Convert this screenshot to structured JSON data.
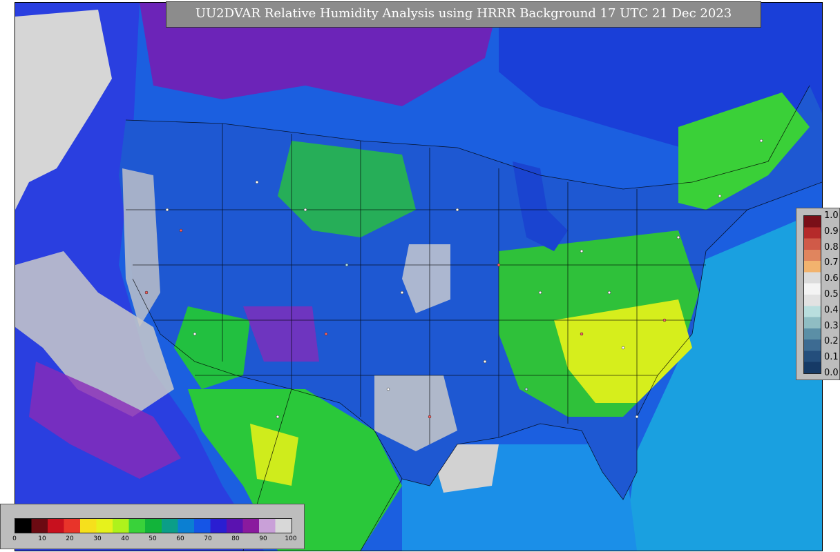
{
  "map": {
    "title": "UU2DVAR Relative Humidity Analysis using HRRR Background 17 UTC 21 Dec 2023",
    "region": "Continental United States",
    "variable": "Relative Humidity"
  },
  "legend_vertical": {
    "ticks": [
      "1.0",
      "0.9",
      "0.8",
      "0.7",
      "0.6",
      "0.5",
      "0.4",
      "0.3",
      "0.2",
      "0.1",
      "0.0"
    ],
    "colors": [
      "#7a0f18",
      "#b52a2a",
      "#d05a48",
      "#e0855e",
      "#f2b36e",
      "#dcdcdc",
      "#f4f4f4",
      "#e2e2e2",
      "#b9dede",
      "#8fbdc3",
      "#5b8fa6",
      "#3d6b92",
      "#244e7c",
      "#163a66"
    ]
  },
  "legend_horizontal": {
    "ticks": [
      "0",
      "10",
      "20",
      "30",
      "40",
      "50",
      "60",
      "70",
      "80",
      "90",
      "100"
    ],
    "colors": [
      "#000000",
      "#6b0a12",
      "#c8101e",
      "#e8342a",
      "#f6e01c",
      "#e6f21c",
      "#aef21c",
      "#39d23a",
      "#12b43a",
      "#0b9e88",
      "#0b7fd2",
      "#1555e6",
      "#2a1ed2",
      "#5a12b0",
      "#8a1a9e",
      "#c9a0d8",
      "#d8d8d8"
    ]
  }
}
